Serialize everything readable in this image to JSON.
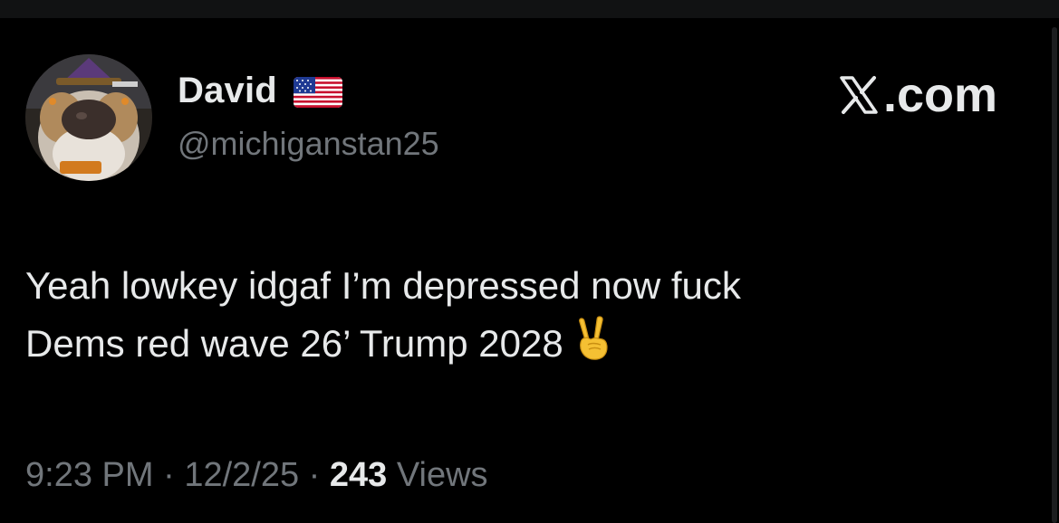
{
  "post": {
    "author": {
      "display_name": "David",
      "flag_icon": "us-flag-icon",
      "handle": "@michiganstan25"
    },
    "source_label": "X.com",
    "text_lines": [
      "Yeah lowkey idgaf I’m depressed now fuck",
      "Dems red wave 26’ Trump 2028"
    ],
    "emoji": "victory-hand-icon",
    "meta": {
      "time": "9:23 PM",
      "date": "12/2/25",
      "separator": "·",
      "views_count": "243",
      "views_label": "Views"
    }
  },
  "colors": {
    "background": "#000000",
    "primary_text": "#e7e9ea",
    "secondary_text": "#71767b"
  }
}
